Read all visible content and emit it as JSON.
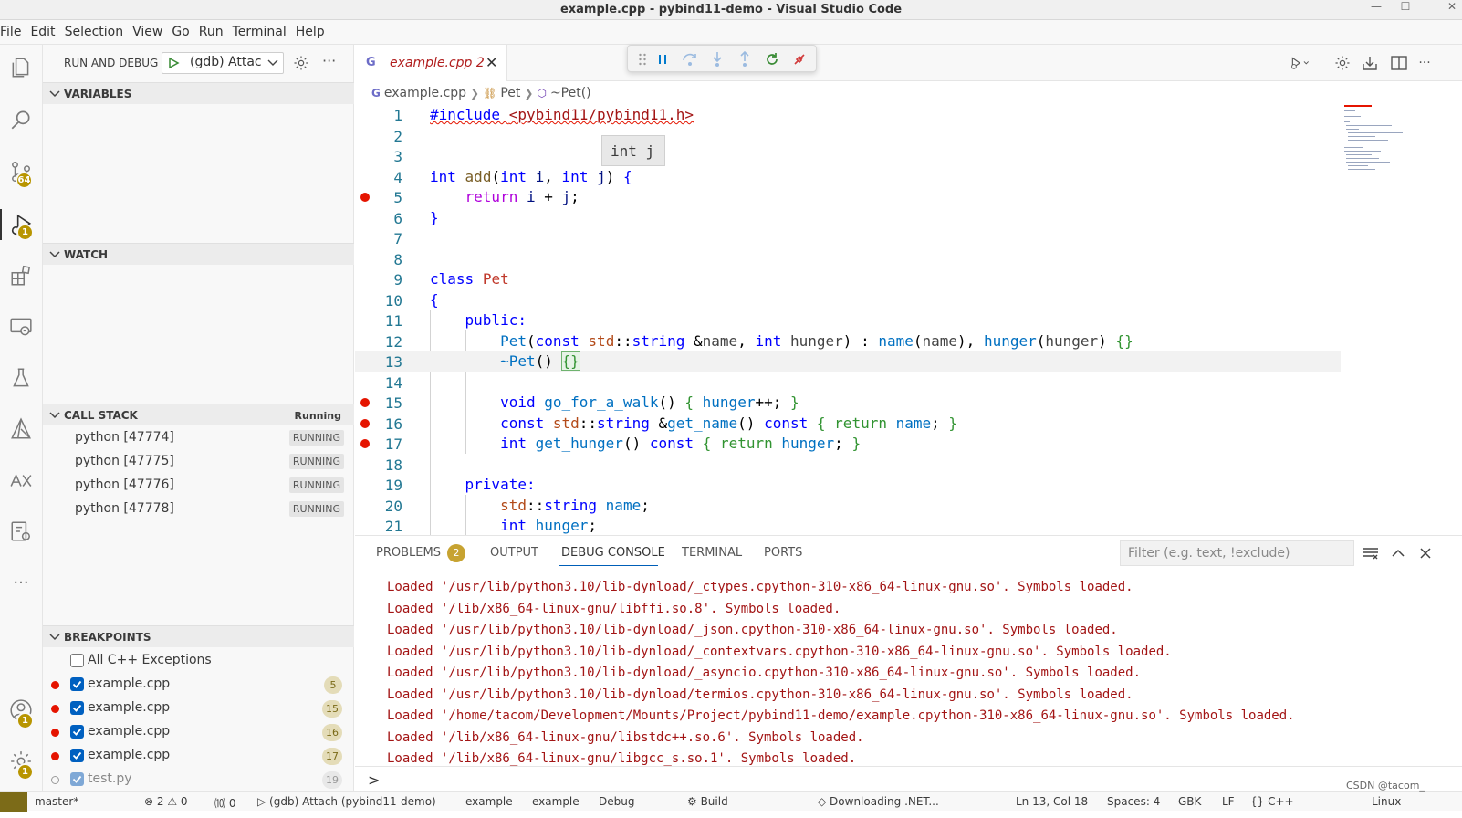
{
  "window": {
    "title": "example.cpp - pybind11-demo - Visual Studio Code"
  },
  "menu": [
    "File",
    "Edit",
    "Selection",
    "View",
    "Go",
    "Run",
    "Terminal",
    "Help"
  ],
  "activity": {
    "source_control_badge": "64",
    "debug_badge": "1",
    "accounts_badge": "1",
    "settings_badge": "1",
    "more": "···"
  },
  "sidebar": {
    "title": "RUN AND DEBUG",
    "config": "(gdb) Attac",
    "sections": {
      "variables": "VARIABLES",
      "watch": "WATCH",
      "call_stack": "CALL STACK",
      "call_stack_state": "Running",
      "breakpoints": "BREAKPOINTS"
    },
    "call_stack": [
      {
        "name": "python [47774]",
        "state": "RUNNING"
      },
      {
        "name": "python [47775]",
        "state": "RUNNING"
      },
      {
        "name": "python [47776]",
        "state": "RUNNING"
      },
      {
        "name": "python [47778]",
        "state": "RUNNING"
      }
    ],
    "breakpoints": [
      {
        "name": "All C++ Exceptions",
        "line": "",
        "checked": false
      },
      {
        "name": "example.cpp",
        "line": "5",
        "checked": true
      },
      {
        "name": "example.cpp",
        "line": "15",
        "checked": true
      },
      {
        "name": "example.cpp",
        "line": "16",
        "checked": true
      },
      {
        "name": "example.cpp",
        "line": "17",
        "checked": true
      },
      {
        "name": "test.py",
        "line": "19",
        "checked": true
      }
    ]
  },
  "editor": {
    "tab": {
      "icon": "G",
      "name": "example.cpp",
      "problems": "2"
    },
    "breadcrumbs": [
      "example.cpp",
      "Pet",
      "~Pet()"
    ],
    "hover": "int j",
    "line_numbers": [
      "1",
      "2",
      "3",
      "4",
      "5",
      "6",
      "7",
      "8",
      "9",
      "10",
      "11",
      "12",
      "13",
      "14",
      "15",
      "16",
      "17",
      "18",
      "19",
      "20",
      "21"
    ],
    "breakpoint_lines": [
      5,
      15,
      16,
      17
    ],
    "current_line": 13,
    "code": {
      "l1_include": "#include",
      "l1_header": "<pybind11/pybind11.h>",
      "kw_int": "int",
      "fn_add": "add",
      "p_i": "i",
      "p_j": "j",
      "kw_return": "return",
      "kw_class": "class",
      "cls_pet": "Pet",
      "kw_public": "public:",
      "kw_private": "private:",
      "kw_const": "const",
      "ns_std": "std",
      "ty_string": "string",
      "v_name": "name",
      "v_hunger": "hunger",
      "dtor": "~Pet",
      "kw_void": "void",
      "fn_walk": "go_for_a_walk",
      "fn_get_name": "get_name",
      "fn_get_hunger": "get_hunger"
    }
  },
  "panel": {
    "tabs": [
      "PROBLEMS",
      "OUTPUT",
      "DEBUG CONSOLE",
      "TERMINAL",
      "PORTS"
    ],
    "problems_count": "2",
    "active_tab": "DEBUG CONSOLE",
    "filter_placeholder": "Filter (e.g. text, !exclude)",
    "console": [
      "Loaded '/usr/lib/python3.10/lib-dynload/_ctypes.cpython-310-x86_64-linux-gnu.so'. Symbols loaded.",
      "Loaded '/lib/x86_64-linux-gnu/libffi.so.8'. Symbols loaded.",
      "Loaded '/usr/lib/python3.10/lib-dynload/_json.cpython-310-x86_64-linux-gnu.so'. Symbols loaded.",
      "Loaded '/usr/lib/python3.10/lib-dynload/_contextvars.cpython-310-x86_64-linux-gnu.so'. Symbols loaded.",
      "Loaded '/usr/lib/python3.10/lib-dynload/_asyncio.cpython-310-x86_64-linux-gnu.so'. Symbols loaded.",
      "Loaded '/usr/lib/python3.10/lib-dynload/termios.cpython-310-x86_64-linux-gnu.so'. Symbols loaded.",
      "Loaded '/home/tacom/Development/Mounts/Project/pybind11-demo/example.cpython-310-x86_64-linux-gnu.so'. Symbols loaded.",
      "Loaded '/lib/x86_64-linux-gnu/libstdc++.so.6'. Symbols loaded.",
      "Loaded '/lib/x86_64-linux-gnu/libgcc_s.so.1'. Symbols loaded."
    ],
    "prompt": ">"
  },
  "status": {
    "branch": "master*",
    "problems": "⊗ 2 ⚠ 0",
    "ports": "⑽ 0",
    "debug": "▷ (gdb) Attach (pybind11-demo)",
    "item1": "example",
    "item2": "example",
    "item3": "Debug",
    "build": "⚙ Build",
    "downloading": "◇ Downloading .NET...",
    "position": "Ln 13, Col 18",
    "spaces": "Spaces: 4",
    "encoding": "GBK",
    "eol": "LF",
    "language": "{} C++",
    "os": "Linux"
  },
  "watermark": "CSDN @tacom_"
}
